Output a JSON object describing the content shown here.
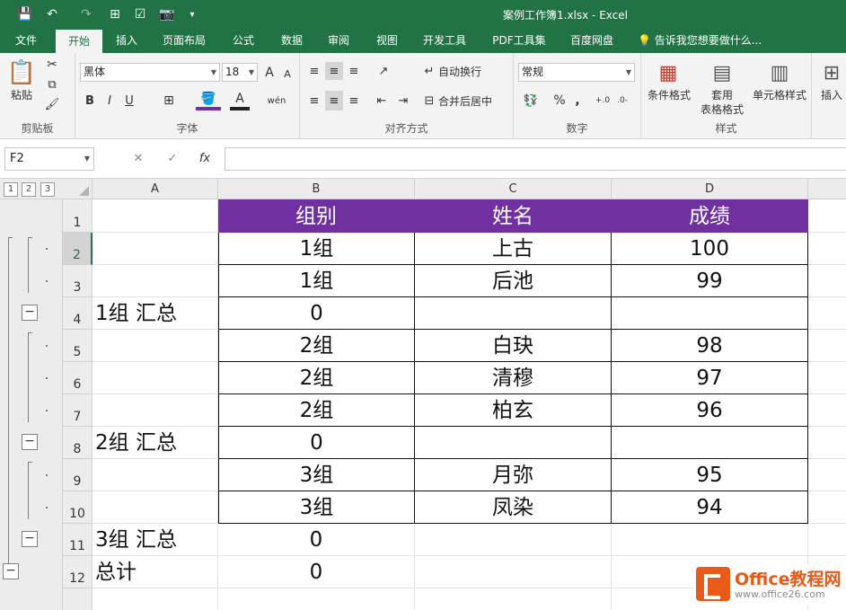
{
  "titlebar": {
    "title": "案例工作簿1.xlsx - Excel",
    "save_icon": "💾",
    "undo_icon": "↶",
    "redo_icon": "↷",
    "extra1_icon": "⊞",
    "extra2_icon": "☑",
    "camera_icon": "📷",
    "customize_icon": "▾"
  },
  "tabs": [
    {
      "label": "文件"
    },
    {
      "label": "开始"
    },
    {
      "label": "插入"
    },
    {
      "label": "页面布局"
    },
    {
      "label": "公式"
    },
    {
      "label": "数据"
    },
    {
      "label": "审阅"
    },
    {
      "label": "视图"
    },
    {
      "label": "开发工具"
    },
    {
      "label": "PDF工具集"
    },
    {
      "label": "百度网盘"
    }
  ],
  "tellme": "告诉我您想要做什么...",
  "ribbon": {
    "clipboard": {
      "label": "剪贴板",
      "paste": "粘贴"
    },
    "font": {
      "label": "字体",
      "name": "黑体",
      "size": "18",
      "bold": "B",
      "italic": "I",
      "underline": "U",
      "grow": "A",
      "shrink": "A"
    },
    "align": {
      "label": "对齐方式",
      "wrap": "自动换行",
      "merge": "合并后居中"
    },
    "number": {
      "label": "数字",
      "format": "常规",
      "percent": "%",
      "comma": ","
    },
    "styles": {
      "label": "样式",
      "cond": "条件格式",
      "table1": "套用",
      "table2": "表格格式",
      "cell": "单元格样式"
    },
    "cells": {
      "insert": "插入"
    }
  },
  "formula": {
    "namebox": "F2",
    "cancel": "✕",
    "enter": "✓",
    "fx": "fx",
    "value": ""
  },
  "outline": {
    "levels": [
      "1",
      "2",
      "3"
    ],
    "minus": "−"
  },
  "columns": [
    "A",
    "B",
    "C",
    "D"
  ],
  "rows": [
    "1",
    "2",
    "3",
    "4",
    "5",
    "6",
    "7",
    "8",
    "9",
    "10",
    "11",
    "12"
  ],
  "sheet": {
    "header": [
      "组别",
      "姓名",
      "成绩"
    ],
    "data": [
      {
        "a": "",
        "b": "1组",
        "c": "上古",
        "d": "100"
      },
      {
        "a": "",
        "b": "1组",
        "c": "后池",
        "d": "99"
      },
      {
        "a": "1组 汇总",
        "b": "0",
        "c": "",
        "d": ""
      },
      {
        "a": "",
        "b": "2组",
        "c": "白玦",
        "d": "98"
      },
      {
        "a": "",
        "b": "2组",
        "c": "清穆",
        "d": "97"
      },
      {
        "a": "",
        "b": "2组",
        "c": "柏玄",
        "d": "96"
      },
      {
        "a": "2组 汇总",
        "b": "0",
        "c": "",
        "d": ""
      },
      {
        "a": "",
        "b": "3组",
        "c": "月弥",
        "d": "95"
      },
      {
        "a": "",
        "b": "3组",
        "c": "凤染",
        "d": "94"
      },
      {
        "a": "3组 汇总",
        "b": "0",
        "c": "",
        "d": ""
      },
      {
        "a": "总计",
        "b": "0",
        "c": "",
        "d": ""
      }
    ]
  },
  "logo": {
    "name": "Office教程网",
    "url": "www.office26.com"
  },
  "colors": {
    "excel_green": "#217346",
    "header_purple": "#7030a0",
    "logo_orange": "#e85a17"
  }
}
